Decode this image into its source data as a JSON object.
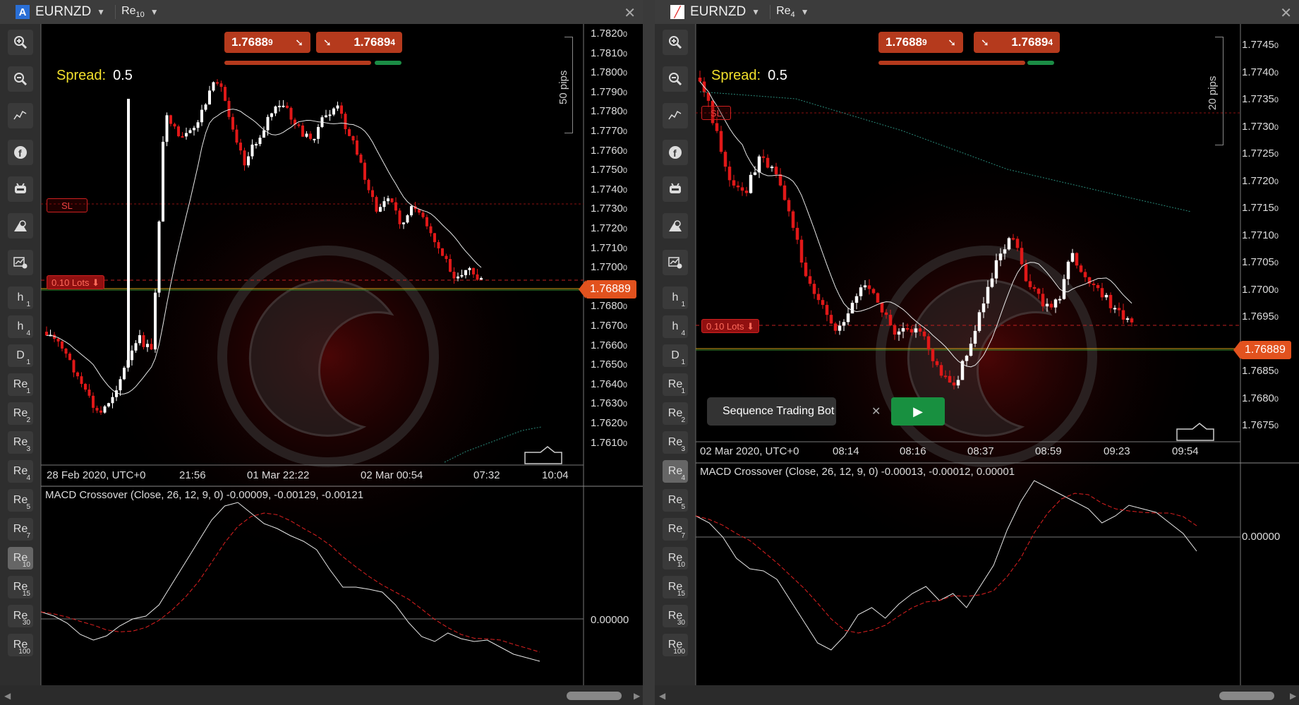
{
  "left": {
    "tab_icon": "A",
    "symbol": "EURNZD",
    "timeframe": {
      "label": "Re",
      "sub": "10"
    },
    "bid": {
      "main": "1.7688",
      "pipette": "9"
    },
    "ask": {
      "main": "1.7689",
      "pipette": "4"
    },
    "spread_label": "Spread:",
    "spread_value": "0.5",
    "pips_label": "50 pips",
    "price_badge": "1.76889",
    "lots_label": "0.10 Lots",
    "sl_label": "SL",
    "macd_title": "MACD Crossover (Close, 26, 12, 9, 0) -0.00009, -0.00129, -0.00121",
    "macd_zero": "0.00000",
    "price_axis": [
      {
        "main": "1.7820",
        "sub": "0"
      },
      {
        "main": "1.7810",
        "sub": "0"
      },
      {
        "main": "1.7800",
        "sub": "0"
      },
      {
        "main": "1.7790",
        "sub": "0"
      },
      {
        "main": "1.7780",
        "sub": "0"
      },
      {
        "main": "1.7770",
        "sub": "0"
      },
      {
        "main": "1.7760",
        "sub": "0"
      },
      {
        "main": "1.7750",
        "sub": "0"
      },
      {
        "main": "1.7740",
        "sub": "0"
      },
      {
        "main": "1.7730",
        "sub": "0"
      },
      {
        "main": "1.7720",
        "sub": "0"
      },
      {
        "main": "1.7710",
        "sub": "0"
      },
      {
        "main": "1.7700",
        "sub": "0"
      },
      {
        "main": "",
        "sub": ""
      },
      {
        "main": "1.7680",
        "sub": "0"
      },
      {
        "main": "1.7670",
        "sub": "0"
      },
      {
        "main": "1.7660",
        "sub": "0"
      },
      {
        "main": "1.7650",
        "sub": "0"
      },
      {
        "main": "1.7640",
        "sub": "0"
      },
      {
        "main": "1.7630",
        "sub": "0"
      },
      {
        "main": "1.7620",
        "sub": "0"
      },
      {
        "main": "1.7610",
        "sub": "0"
      }
    ],
    "time_axis": [
      "28 Feb 2020, UTC+0",
      "21:56",
      "01 Mar 22:22",
      "02 Mar 00:54",
      "07:32",
      "10:04"
    ]
  },
  "right": {
    "symbol": "EURNZD",
    "timeframe": {
      "label": "Re",
      "sub": "4"
    },
    "bid": {
      "main": "1.7688",
      "pipette": "9"
    },
    "ask": {
      "main": "1.7689",
      "pipette": "4"
    },
    "spread_label": "Spread:",
    "spread_value": "0.5",
    "pips_label": "20 pips",
    "price_badge": "1.76889",
    "lots_label": "0.10 Lots",
    "sl_label": "SL",
    "macd_title": "MACD Crossover (Close, 26, 12, 9, 0) -0.00013, -0.00012, 0.00001",
    "macd_zero": "0.00000",
    "price_axis": [
      {
        "main": "1.7745",
        "sub": "0"
      },
      {
        "main": "1.7740",
        "sub": "0"
      },
      {
        "main": "1.7735",
        "sub": "0"
      },
      {
        "main": "1.7730",
        "sub": "0"
      },
      {
        "main": "1.7725",
        "sub": "0"
      },
      {
        "main": "1.7720",
        "sub": "0"
      },
      {
        "main": "1.7715",
        "sub": "0"
      },
      {
        "main": "1.7710",
        "sub": "0"
      },
      {
        "main": "1.7705",
        "sub": "0"
      },
      {
        "main": "1.7700",
        "sub": "0"
      },
      {
        "main": "1.7695",
        "sub": "0"
      },
      {
        "main": "",
        "sub": ""
      },
      {
        "main": "1.7685",
        "sub": "0"
      },
      {
        "main": "1.7680",
        "sub": "0"
      },
      {
        "main": "1.7675",
        "sub": "0"
      }
    ],
    "time_axis": [
      "02 Mar 2020, UTC+0",
      "08:14",
      "08:16",
      "08:37",
      "08:59",
      "09:23",
      "09:54"
    ],
    "bot_name": "Sequence Trading Bot"
  },
  "tools": [
    "zoom-in-icon",
    "zoom-out-icon",
    "chart-type-icon",
    "facebook-icon",
    "bot-icon",
    "drawing-icon",
    "settings-icon"
  ],
  "timeframes": [
    {
      "label": "h",
      "sub": "1"
    },
    {
      "label": "h",
      "sub": "4"
    },
    {
      "label": "D",
      "sub": "1"
    },
    {
      "label": "Re",
      "sub": "1"
    },
    {
      "label": "Re",
      "sub": "2"
    },
    {
      "label": "Re",
      "sub": "3"
    },
    {
      "label": "Re",
      "sub": "4"
    },
    {
      "label": "Re",
      "sub": "5"
    },
    {
      "label": "Re",
      "sub": "7"
    },
    {
      "label": "Re",
      "sub": "10"
    },
    {
      "label": "Re",
      "sub": "15"
    },
    {
      "label": "Re",
      "sub": "30"
    },
    {
      "label": "Re",
      "sub": "100"
    }
  ],
  "colors": {
    "bull": "#ffffff",
    "bear": "#e01818",
    "macd_signal": "#e02020",
    "badge": "#e2521e",
    "bid_box": "#b53a1d",
    "play": "#189040"
  }
}
